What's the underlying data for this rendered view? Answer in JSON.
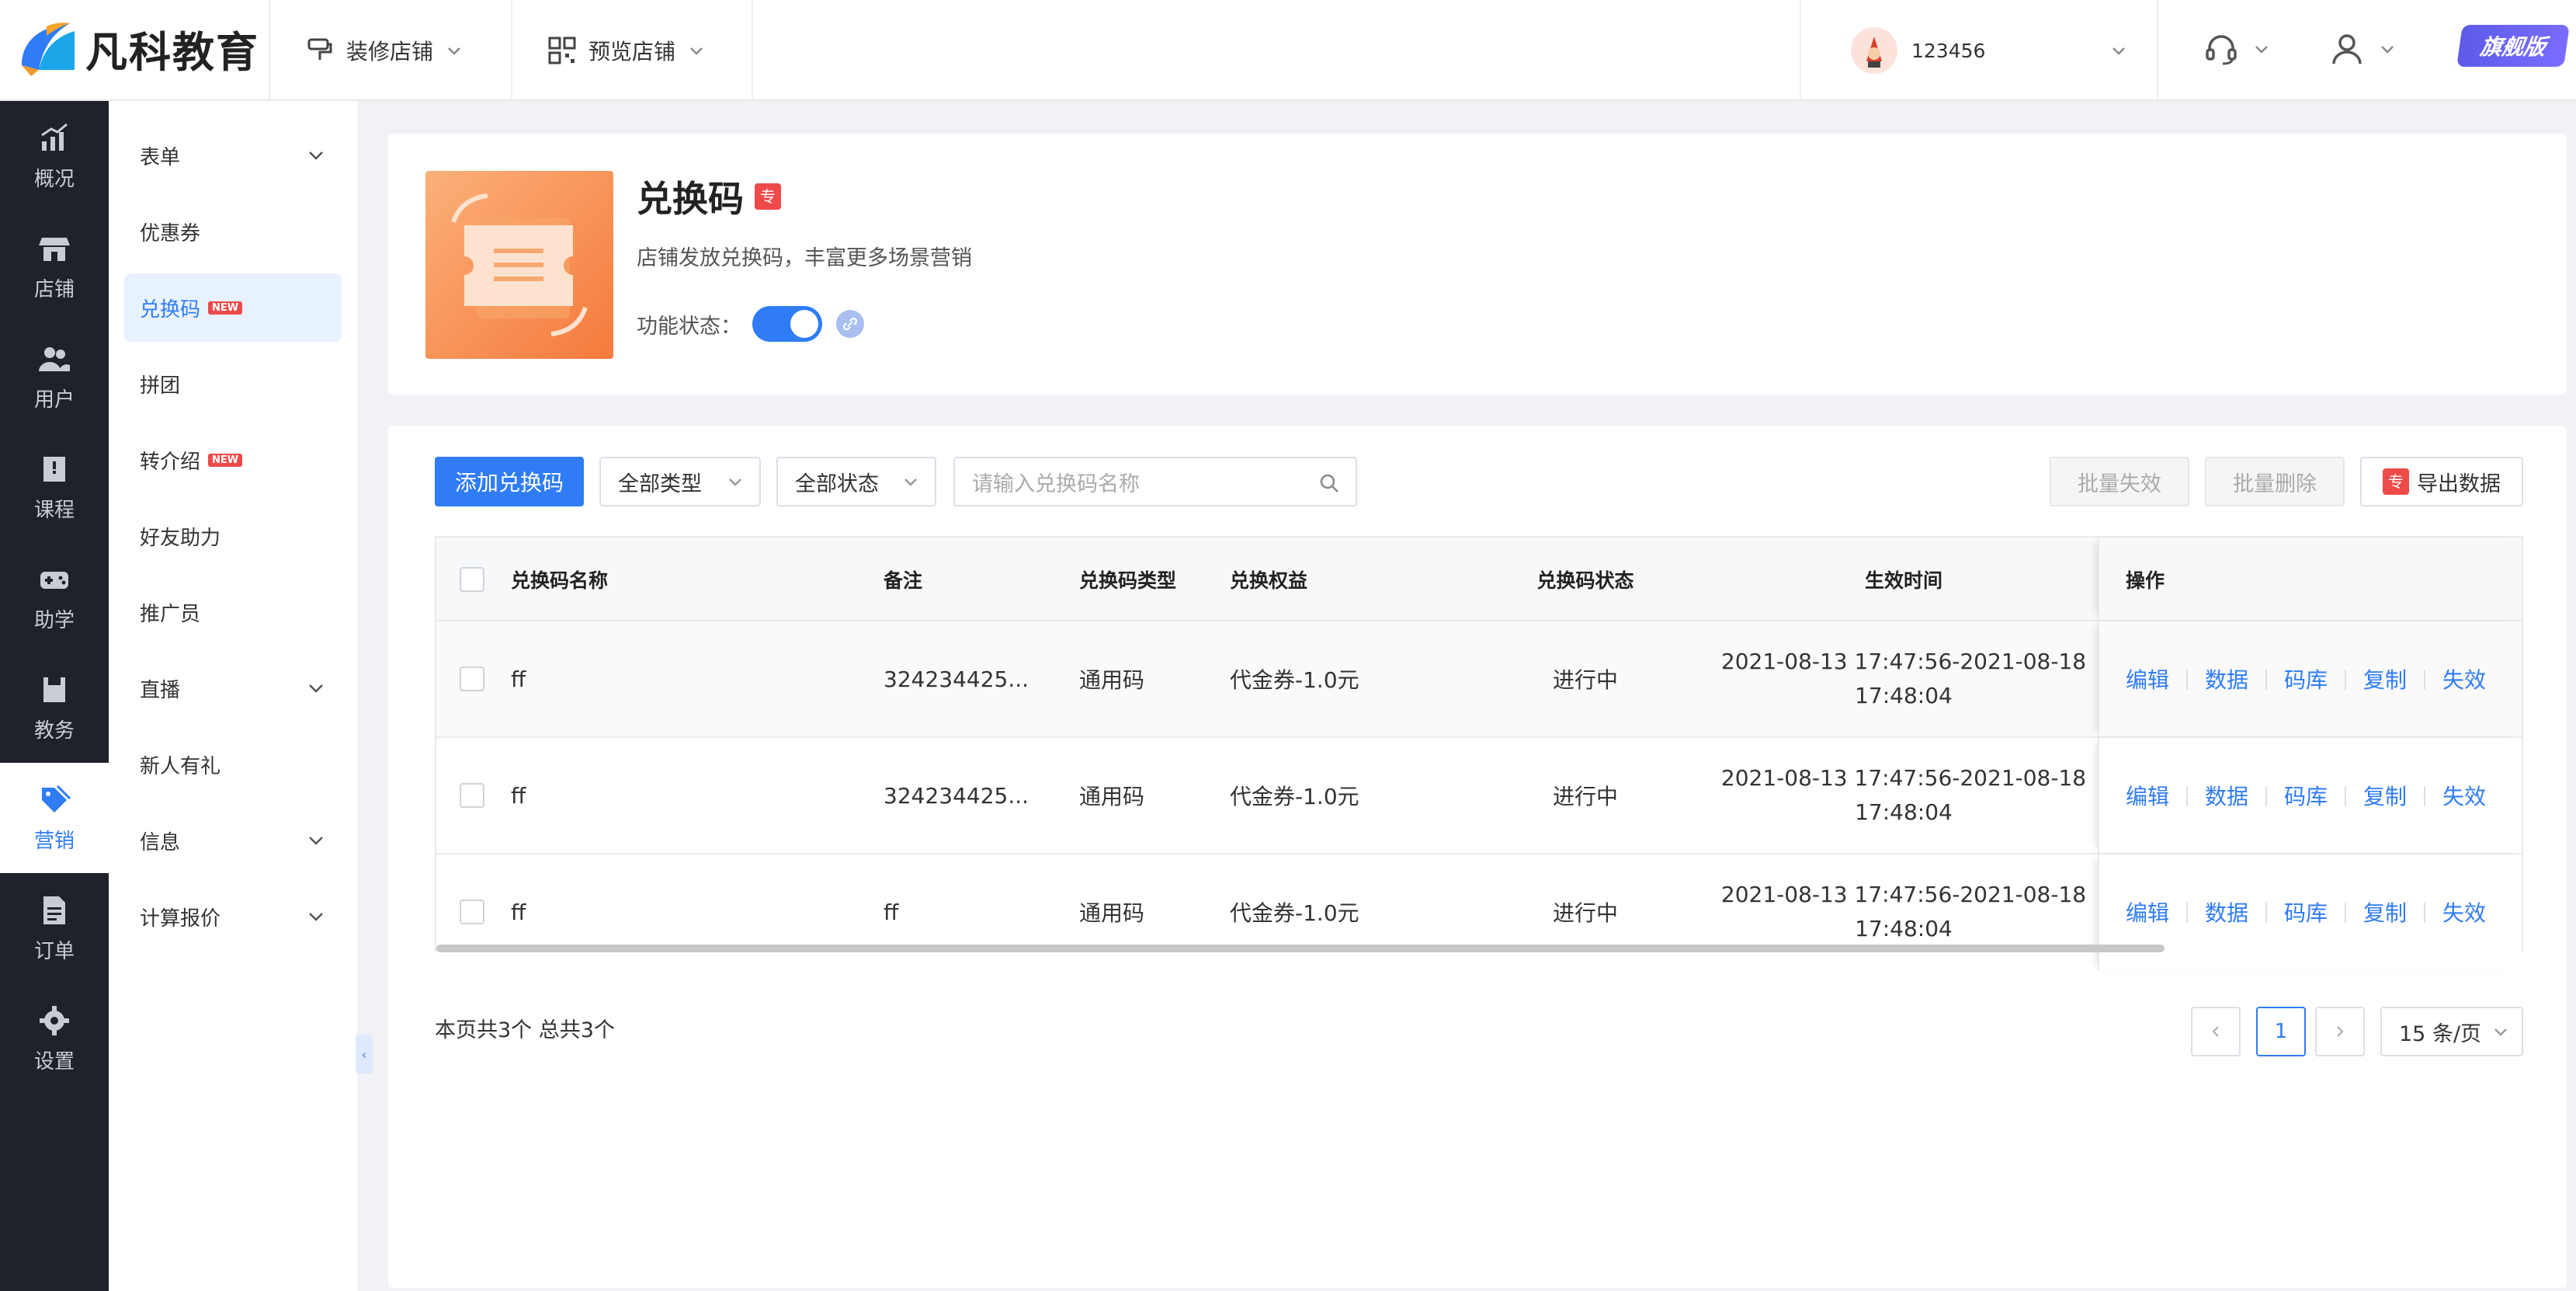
{
  "brand": {
    "name": "凡科教育"
  },
  "topnav": {
    "decorate": "装修店铺",
    "preview": "预览店铺",
    "username": "123456",
    "vip": "旗舰版"
  },
  "rail": [
    {
      "label": "概况",
      "icon": "chart-icon"
    },
    {
      "label": "店铺",
      "icon": "store-icon"
    },
    {
      "label": "用户",
      "icon": "users-icon"
    },
    {
      "label": "课程",
      "icon": "book-icon"
    },
    {
      "label": "助学",
      "icon": "gamepad-icon"
    },
    {
      "label": "教务",
      "icon": "notebook-icon"
    },
    {
      "label": "营销",
      "icon": "tag-icon",
      "active": true
    },
    {
      "label": "订单",
      "icon": "document-icon"
    },
    {
      "label": "设置",
      "icon": "gear-icon"
    }
  ],
  "sidebar": [
    {
      "label": "表单",
      "expand": true
    },
    {
      "label": "优惠券"
    },
    {
      "label": "兑换码",
      "badge": "NEW",
      "active": true
    },
    {
      "label": "拼团"
    },
    {
      "label": "转介绍",
      "badge": "NEW"
    },
    {
      "label": "好友助力"
    },
    {
      "label": "推广员"
    },
    {
      "label": "直播",
      "expand": true
    },
    {
      "label": "新人有礼"
    },
    {
      "label": "信息",
      "expand": true
    },
    {
      "label": "计算报价",
      "expand": true
    }
  ],
  "feature": {
    "title": "兑换码",
    "pro_badge": "专",
    "desc": "店铺发放兑换码，丰富更多场景营销",
    "status_label": "功能状态：",
    "enabled": true
  },
  "toolbar": {
    "add": "添加兑换码",
    "type_filter": "全部类型",
    "status_filter": "全部状态",
    "search_placeholder": "请输入兑换码名称",
    "batch_disable": "批量失效",
    "batch_delete": "批量删除",
    "export": "导出数据",
    "export_badge": "专"
  },
  "table": {
    "headers": {
      "name": "兑换码名称",
      "remark": "备注",
      "type": "兑换码类型",
      "benefit": "兑换权益",
      "status": "兑换码状态",
      "time": "生效时间",
      "ops": "操作"
    },
    "rows": [
      {
        "name": "ff",
        "remark": "324234425...",
        "type": "通用码",
        "benefit": "代金券-1.0元",
        "status": "进行中",
        "time1": "2021-08-13 17:47:56-2021-08-18",
        "time2": "17:48:04"
      },
      {
        "name": "ff",
        "remark": "324234425...",
        "type": "通用码",
        "benefit": "代金券-1.0元",
        "status": "进行中",
        "time1": "2021-08-13 17:47:56-2021-08-18",
        "time2": "17:48:04"
      },
      {
        "name": "ff",
        "remark": "ff",
        "type": "通用码",
        "benefit": "代金券-1.0元",
        "status": "进行中",
        "time1": "2021-08-13 17:47:56-2021-08-18",
        "time2": "17:48:04"
      }
    ],
    "actions": [
      "编辑",
      "数据",
      "码库",
      "复制",
      "失效"
    ]
  },
  "pagination": {
    "summary": "本页共3个 总共3个",
    "current_page": "1",
    "page_size": "15 条/页"
  },
  "colors": {
    "accent": "#2f7cf6",
    "rail_bg": "#1f2228",
    "badge_red": "#ee4a4a"
  }
}
